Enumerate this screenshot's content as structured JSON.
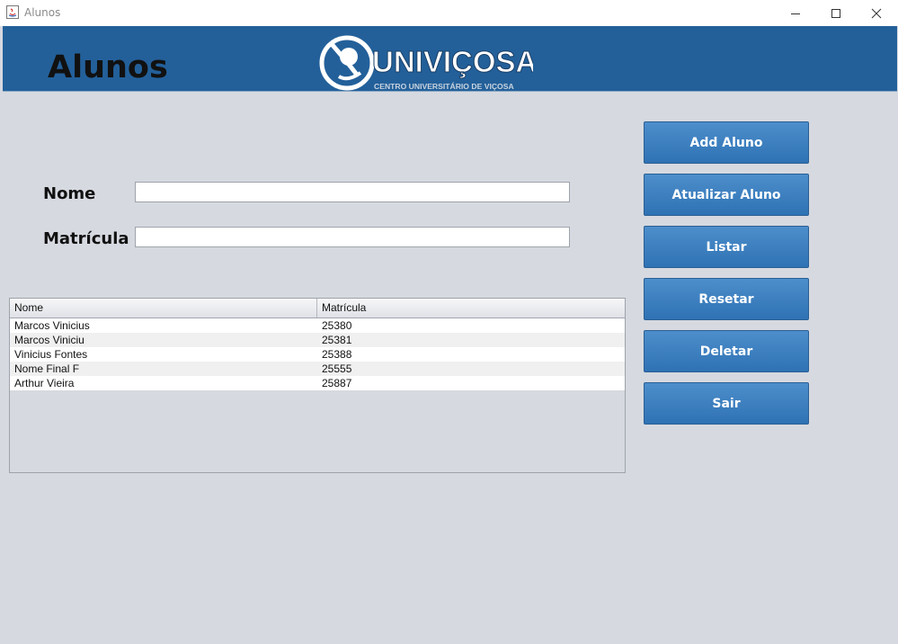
{
  "window": {
    "title": "Alunos"
  },
  "header": {
    "page_title": "Alunos",
    "logo_name": "UNIVIÇOSA",
    "logo_subtitle": "CENTRO UNIVERSITÁRIO DE VIÇOSA",
    "color": "#23609a"
  },
  "form": {
    "nome_label": "Nome",
    "nome_value": "",
    "matricula_label": "Matrícula",
    "matricula_value": ""
  },
  "table": {
    "columns": [
      "Nome",
      "Matrícula"
    ],
    "rows": [
      [
        "Marcos Vinicius",
        "25380"
      ],
      [
        "Marcos Viniciu",
        "25381"
      ],
      [
        "Vinicius Fontes",
        "25388"
      ],
      [
        "Nome Final F",
        "25555"
      ],
      [
        "Arthur Vieira",
        "25887"
      ]
    ]
  },
  "buttons": {
    "add": "Add Aluno",
    "update": "Atualizar Aluno",
    "list": "Listar",
    "reset": "Resetar",
    "delete": "Deletar",
    "exit": "Sair"
  }
}
